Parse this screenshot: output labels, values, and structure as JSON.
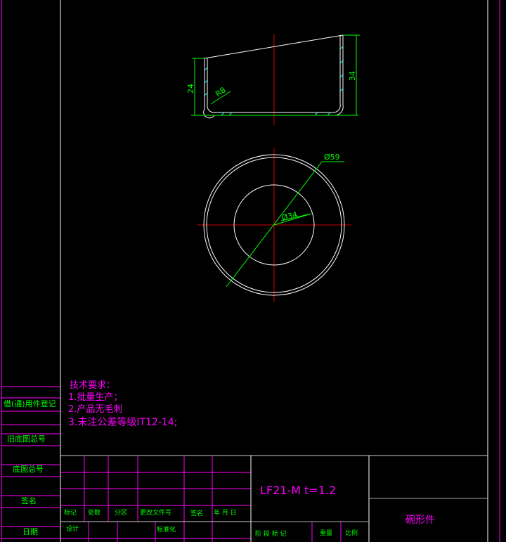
{
  "side_view": {
    "dim_left": "24",
    "dim_right": "34",
    "radius": "R8"
  },
  "plan_view": {
    "outer_dia": "Ø59",
    "inner_dia": "Ø34"
  },
  "notes": {
    "title": "技术要求：",
    "items": [
      "1.批量生产；",
      "2.产品无毛刺",
      "3.未注公差等级IT12-14;"
    ]
  },
  "left_strip": {
    "labels": [
      "借(通)用件登记",
      "旧底图总号",
      "底图总号",
      "签名",
      "日期"
    ]
  },
  "title_block": {
    "headers": [
      "标记",
      "处数",
      "分区",
      "更改文件号",
      "签名",
      "年  月  日"
    ],
    "row2": [
      "设计",
      "标准化"
    ],
    "material": "LF21-M  t=1.2",
    "part_name": "碗形件",
    "stage_mark": "阶 段 标 记",
    "weight": "重量",
    "scale": "比例"
  },
  "colors": {
    "green": "#00ff00",
    "magenta": "#ff00ff",
    "white": "#ffffff",
    "red": "#cc0000",
    "cyan": "#00ffff"
  }
}
